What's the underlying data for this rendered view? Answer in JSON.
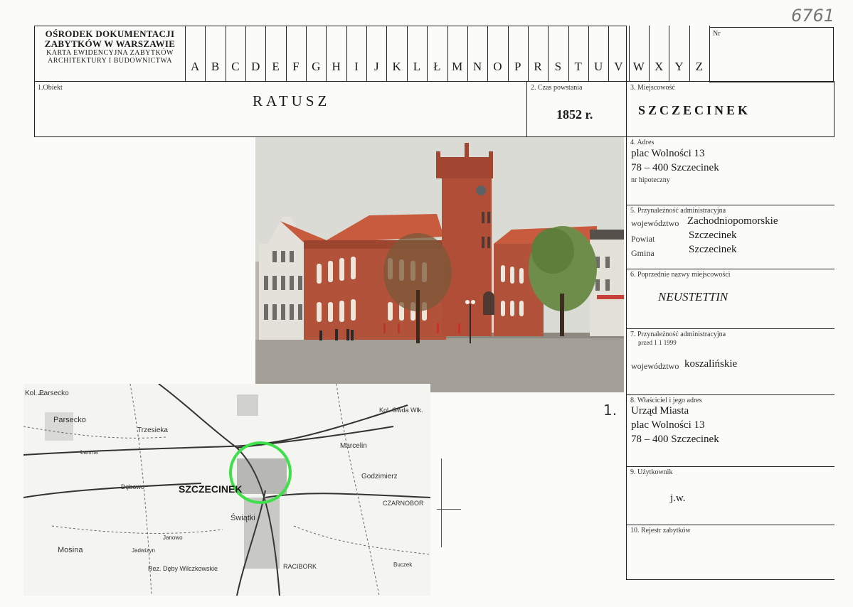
{
  "handwritten_number": "6761",
  "header": {
    "line1": "OŚRODEK DOKUMENTACJI",
    "line2": "ZABYTKÓW W WARSZAWIE",
    "line3": "KARTA EWIDENCYJNA ZABYTKÓW",
    "line4": "ARCHITEKTURY I BUDOWNICTWA",
    "nr_label": "Nr"
  },
  "letters": [
    "A",
    "B",
    "C",
    "D",
    "E",
    "F",
    "G",
    "H",
    "I",
    "J",
    "K",
    "L",
    "Ł",
    "M",
    "N",
    "O",
    "P",
    "R",
    "S",
    "T",
    "U",
    "V",
    "W",
    "X",
    "Y",
    "Z"
  ],
  "obiekt": {
    "label": "1.Obiekt",
    "value": "RATUSZ"
  },
  "czas": {
    "label": "2. Czas powstania",
    "value": "1852 r."
  },
  "miejscowosc": {
    "label": "3. Miejscowość",
    "value": "SZCZECINEK"
  },
  "adres": {
    "label": "4. Adres",
    "line1": "plac Wolności 13",
    "line2": "78 – 400 Szczecinek",
    "hip": "nr hipoteczny"
  },
  "admin": {
    "label": "5. Przynależność administracyjna",
    "woj_label": "województwo",
    "woj_value": "Zachodniopomorskie",
    "powiat_label": "Powiat",
    "powiat_value": "Szczecinek",
    "gmina_label": "Gmina",
    "gmina_value": "Szczecinek"
  },
  "poprzednie": {
    "label": "6. Poprzednie nazwy miejscowości",
    "value": "NEUSTETTIN"
  },
  "admin_old": {
    "label1": "7. Przynależność administracyjna",
    "label2": "przed 1 1 1999",
    "woj_label": "województwo",
    "woj_value": "koszalińskie"
  },
  "wlasciciel": {
    "label": "8. Właściciel i jego adres",
    "line1": "Urząd Miasta",
    "line2": "plac Wolności 13",
    "line3": "78 – 400 Szczecinek"
  },
  "uzytkownik": {
    "label": "9. Użytkownik",
    "value": "j.w."
  },
  "rejestr": {
    "label": "10. Rejestr zabytków"
  },
  "photo_number": "1.",
  "map_labels": {
    "parsecko_top": "Kol. Parsecko",
    "parsecko": "Parsecko",
    "trzesieka": "Trzesieka",
    "szczecinek": "SZCZECINEK",
    "marcelin": "Marcelin",
    "godzimierz": "Godzimierz",
    "gwda": "Kol. Gwda Wlk.",
    "czarnobor": "CZARNOBOR",
    "mosina": "Mosina",
    "janowo": "Janowo",
    "jadwizyn": "Jadwizyn",
    "swiatki": "Świątki",
    "racibork": "RACIBORK",
    "buczek": "Buczek",
    "deby": "Rez. Dęby Wilczkowskie",
    "debowo": "Dębowo",
    "lamna": "Lamna"
  },
  "colors": {
    "ink": "#1a1a1a",
    "brick": "#b2523a",
    "roof": "#c85a3e",
    "sky": "#d9dbd4",
    "map_circle": "#3ee04a"
  }
}
